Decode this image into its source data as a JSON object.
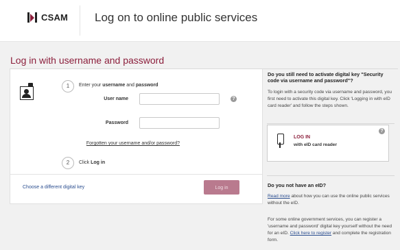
{
  "header": {
    "logo_text": "CSAM",
    "title": "Log on to online public services"
  },
  "login": {
    "section_title": "Log in with username and password",
    "step1_number": "1",
    "step1_prefix": "Enter your ",
    "step1_username": "username",
    "step1_and": " and ",
    "step1_password": "password",
    "username_label": "User name",
    "password_label": "Password",
    "username_value": "",
    "password_value": "",
    "help_symbol": "?",
    "forgot_link": "Forgotten your username and/or password?",
    "step2_number": "2",
    "step2_prefix": "Click ",
    "step2_action": "Log in",
    "choose_key_link": "Choose a different digital key",
    "login_button": "Log in"
  },
  "sidebar": {
    "activate_title": "Do you still need to activate digital key \"Security code via username and password\"?",
    "activate_text": "To login with a security code via username and password, you first need to activate this digital key. Click 'Logging in with eID card reader' and follow the steps shown.",
    "eid_card_title": "LOG IN",
    "eid_card_subtitle": "with eID card reader",
    "help_symbol": "?",
    "no_eid_title": "Do you not have an eID?",
    "read_more_link": "Read more",
    "read_more_text": " about how you can use the online public services without the eID.",
    "register_text_1": "For some online government services, you can register a 'username and password' digital key yourself without the need for an eID. ",
    "click_here_link": "Click here to register",
    "register_text_2": " and complete the registration form."
  },
  "colors": {
    "brand": "#8c1f3c",
    "button": "#b97a8e",
    "link": "#2a4d8f"
  }
}
